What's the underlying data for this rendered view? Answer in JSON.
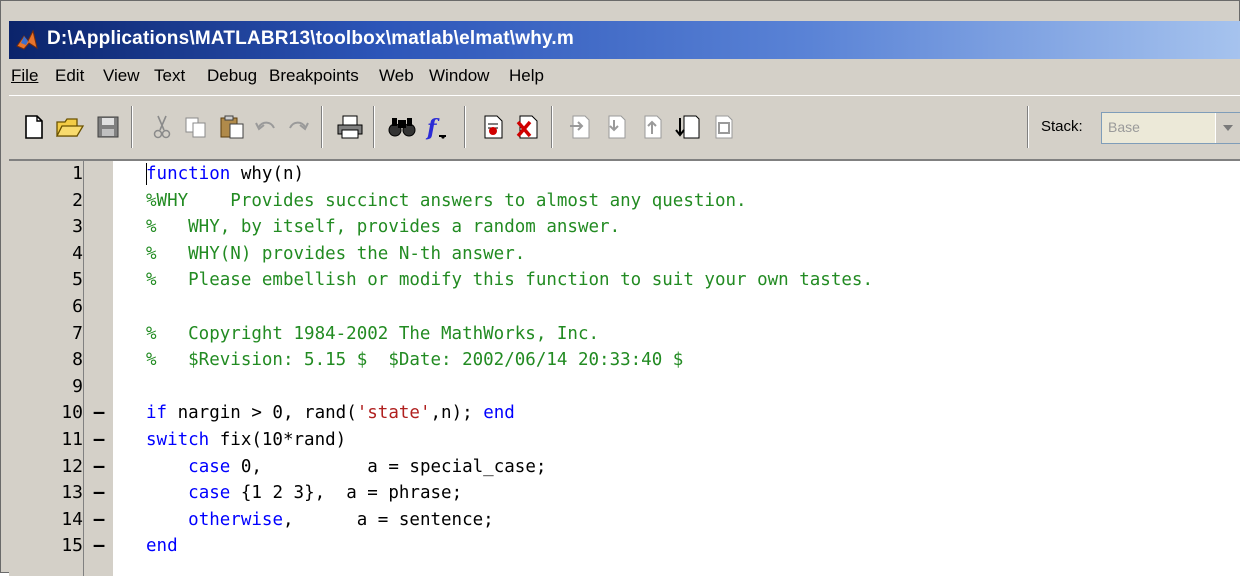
{
  "window": {
    "title": "D:\\Applications\\MATLABR13\\toolbox\\matlab\\elmat\\why.m",
    "icon": "matlab-icon"
  },
  "menu": [
    {
      "label": "File"
    },
    {
      "label": "Edit"
    },
    {
      "label": "View"
    },
    {
      "label": "Text"
    },
    {
      "label": "Debug"
    },
    {
      "label": "Breakpoints"
    },
    {
      "label": "Web"
    },
    {
      "label": "Window"
    },
    {
      "label": "Help"
    }
  ],
  "toolbar": {
    "buttons": [
      {
        "icon": "new-file-icon"
      },
      {
        "icon": "open-folder-icon"
      },
      {
        "icon": "save-icon"
      },
      {
        "icon": "cut-icon"
      },
      {
        "icon": "copy-icon"
      },
      {
        "icon": "paste-icon"
      },
      {
        "icon": "undo-icon"
      },
      {
        "icon": "redo-icon"
      },
      {
        "icon": "print-icon"
      },
      {
        "icon": "find-icon"
      },
      {
        "icon": "function-icon"
      },
      {
        "icon": "set-breakpoint-icon"
      },
      {
        "icon": "clear-breakpoints-icon"
      },
      {
        "icon": "step-icon"
      },
      {
        "icon": "step-in-icon"
      },
      {
        "icon": "step-out-icon"
      },
      {
        "icon": "continue-icon"
      },
      {
        "icon": "exit-debug-icon"
      }
    ],
    "stack_label": "Stack:",
    "stack_value": "Base"
  },
  "editor": {
    "lines": [
      {
        "n": "1",
        "bp": "",
        "segs": [
          {
            "t": "function",
            "c": "kw"
          },
          {
            "t": " why(n)",
            "c": ""
          }
        ]
      },
      {
        "n": "2",
        "bp": "",
        "segs": [
          {
            "t": "%WHY    Provides succinct answers to almost any question.",
            "c": "cm"
          }
        ]
      },
      {
        "n": "3",
        "bp": "",
        "segs": [
          {
            "t": "%   WHY, by itself, provides a random answer.",
            "c": "cm"
          }
        ]
      },
      {
        "n": "4",
        "bp": "",
        "segs": [
          {
            "t": "%   WHY(N) provides the N-th answer.",
            "c": "cm"
          }
        ]
      },
      {
        "n": "5",
        "bp": "",
        "segs": [
          {
            "t": "%   Please embellish or modify this function to suit your own tastes.",
            "c": "cm"
          }
        ]
      },
      {
        "n": "6",
        "bp": "",
        "segs": []
      },
      {
        "n": "7",
        "bp": "",
        "segs": [
          {
            "t": "%   Copyright 1984-2002 The MathWorks, Inc.",
            "c": "cm"
          }
        ]
      },
      {
        "n": "8",
        "bp": "",
        "segs": [
          {
            "t": "%   $Revision: 5.15 $  $Date: 2002/06/14 20:33:40 $",
            "c": "cm"
          }
        ]
      },
      {
        "n": "9",
        "bp": "",
        "segs": []
      },
      {
        "n": "10",
        "bp": "–",
        "segs": [
          {
            "t": "if",
            "c": "kw"
          },
          {
            "t": " nargin > 0, rand(",
            "c": ""
          },
          {
            "t": "'state'",
            "c": "stred"
          },
          {
            "t": ",n); ",
            "c": ""
          },
          {
            "t": "end",
            "c": "kw"
          }
        ]
      },
      {
        "n": "11",
        "bp": "–",
        "segs": [
          {
            "t": "switch",
            "c": "kw"
          },
          {
            "t": " fix(10*rand)",
            "c": ""
          }
        ]
      },
      {
        "n": "12",
        "bp": "–",
        "segs": [
          {
            "t": "    ",
            "c": ""
          },
          {
            "t": "case",
            "c": "kw"
          },
          {
            "t": " 0,          a = special_case;",
            "c": ""
          }
        ]
      },
      {
        "n": "13",
        "bp": "–",
        "segs": [
          {
            "t": "    ",
            "c": ""
          },
          {
            "t": "case",
            "c": "kw"
          },
          {
            "t": " {1 2 3},  a = phrase;",
            "c": ""
          }
        ]
      },
      {
        "n": "14",
        "bp": "–",
        "segs": [
          {
            "t": "    ",
            "c": ""
          },
          {
            "t": "otherwise",
            "c": "kw"
          },
          {
            "t": ",      a = sentence;",
            "c": ""
          }
        ]
      },
      {
        "n": "15",
        "bp": "–",
        "segs": [
          {
            "t": "end",
            "c": "kw"
          }
        ]
      }
    ]
  }
}
